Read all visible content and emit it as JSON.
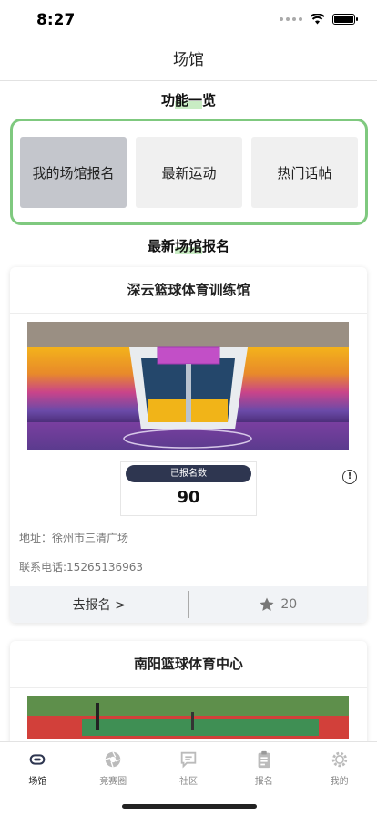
{
  "status": {
    "time": "8:27"
  },
  "nav": {
    "title": "场馆"
  },
  "features": {
    "title_pre": "功",
    "title_hl": "能一",
    "title_post": "览",
    "items": [
      {
        "label": "我的场馆报名",
        "active": true
      },
      {
        "label": "最新运动",
        "active": false
      },
      {
        "label": "热门话帖",
        "active": false
      }
    ]
  },
  "latest": {
    "title_pre": "最新",
    "title_hl": "场馆",
    "title_post": "报名"
  },
  "venues": [
    {
      "name": "深云篮球体育训练馆",
      "signup_label": "已报名数",
      "signup_count": "90",
      "address": "地址：徐州市三清广场",
      "phone": "联系电话:15265136963",
      "action": "去报名 >",
      "stars": "20"
    },
    {
      "name": "南阳篮球体育中心"
    }
  ],
  "tabs": [
    {
      "label": "场馆",
      "icon": "venue-icon",
      "active": true
    },
    {
      "label": "竞赛圈",
      "icon": "camera-icon",
      "active": false
    },
    {
      "label": "社区",
      "icon": "chat-icon",
      "active": false
    },
    {
      "label": "报名",
      "icon": "clipboard-icon",
      "active": false
    },
    {
      "label": "我的",
      "icon": "gear-icon",
      "active": false
    }
  ],
  "colors": {
    "accent_green": "#7fc97f",
    "badge_navy": "#2e3650",
    "active_tab": "#2e3650"
  }
}
